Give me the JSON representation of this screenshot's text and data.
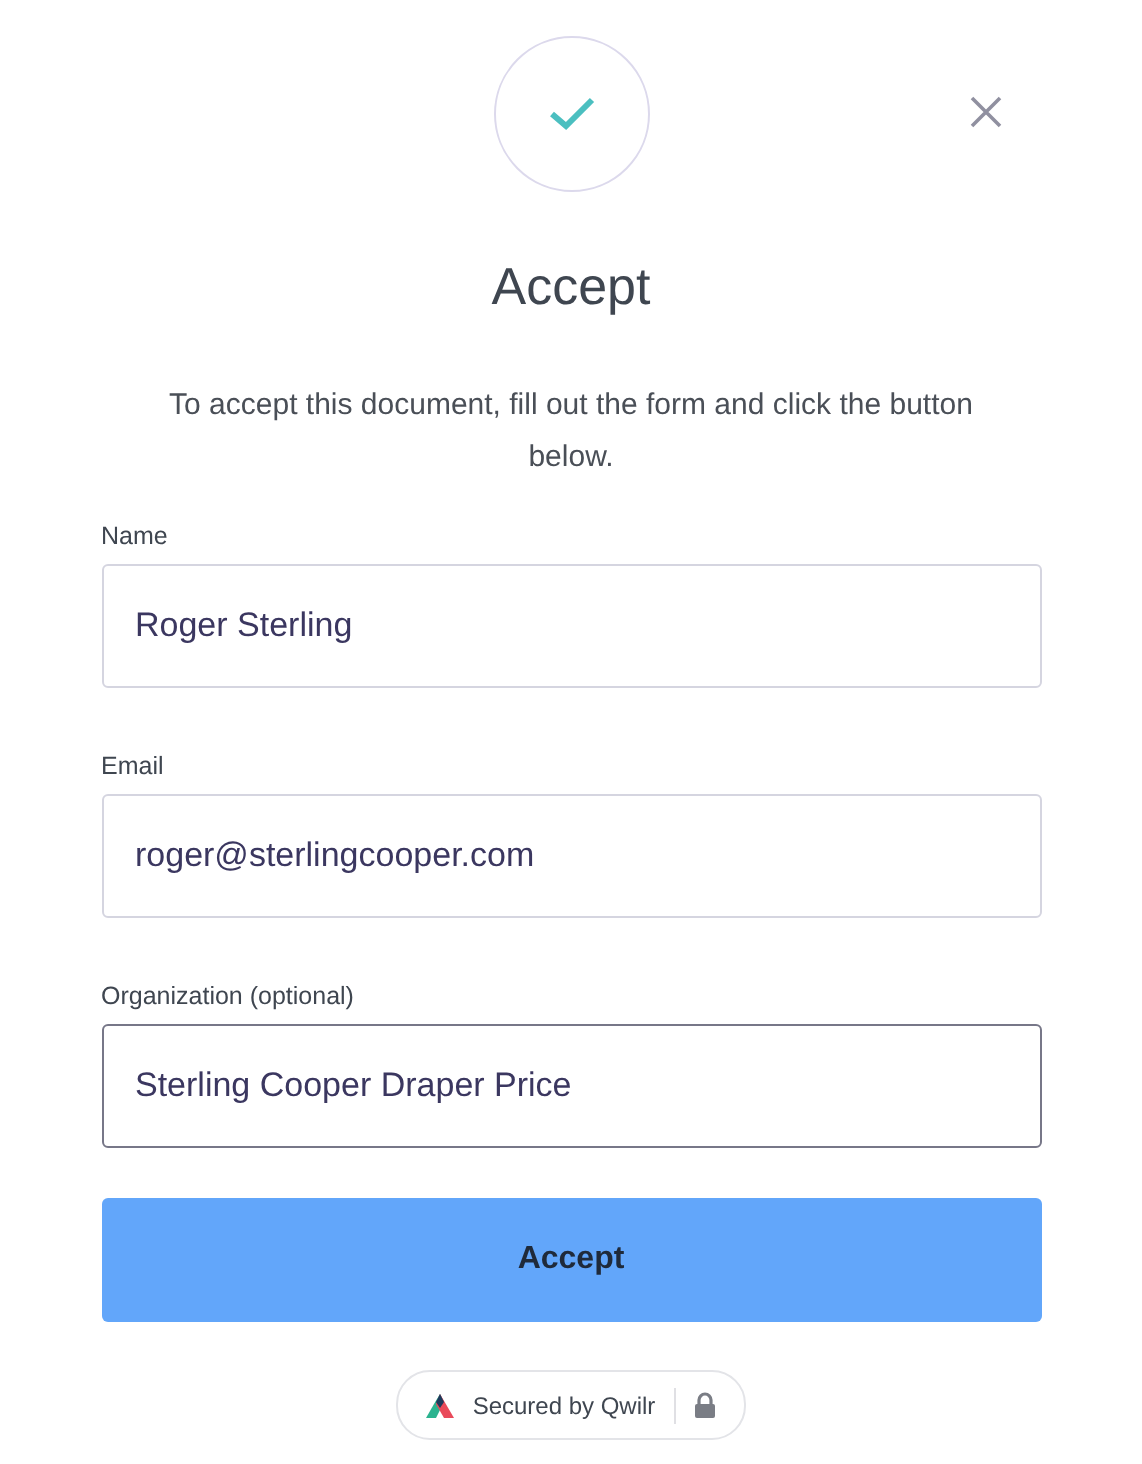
{
  "title": "Accept",
  "description": "To accept this document, fill out the form and click the button below.",
  "fields": [
    {
      "label": "Name",
      "value": "Roger Sterling",
      "focused": false
    },
    {
      "label": "Email",
      "value": "roger@sterlingcooper.com",
      "focused": false
    },
    {
      "label": "Organization (optional)",
      "value": "Sterling Cooper Draper Price",
      "focused": true
    }
  ],
  "submit": "Accept",
  "badge": "Secured by Qwilr"
}
